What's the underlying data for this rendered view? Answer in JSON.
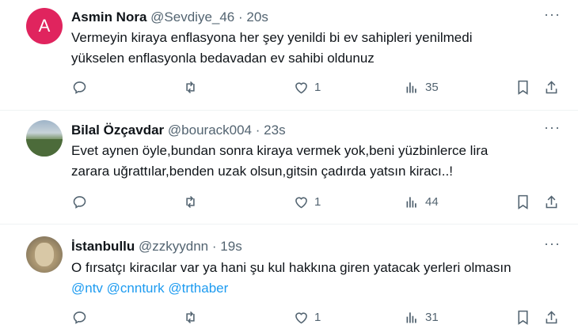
{
  "tweets": [
    {
      "avatar_letter": "A",
      "name": "Asmin Nora",
      "handle": "@Sevdiye_46",
      "separator": "·",
      "time": "20s",
      "more": "···",
      "text_lines": [
        "Vermeyin kiraya enflasyona her şey yenildi bi ev sahipleri yenilmedi",
        "yükselen enflasyonla bedavadan ev sahibi oldunuz"
      ],
      "likes": "1",
      "views": "35"
    },
    {
      "avatar_desc": "landscape photo avatar",
      "name": "Bilal Özçavdar",
      "handle": "@bourack004",
      "separator": "·",
      "time": "23s",
      "more": "···",
      "text_lines": [
        "Evet aynen öyle,bundan sonra kiraya vermek yok,beni yüzbinlerce lira",
        "zarara uğrattılar,benden uzak olsun,gitsin çadırda yatsın kiracı..!"
      ],
      "likes": "1",
      "views": "44"
    },
    {
      "avatar_desc": "cat photo avatar",
      "name": "İstanbullu",
      "handle": "@zzkyydnn",
      "separator": "·",
      "time": "19s",
      "more": "···",
      "text_lines": [
        "O fırsatçı kiracılar var ya hani şu kul hakkına giren yatacak yerleri olmasın"
      ],
      "mentions": [
        "@ntv",
        "@cnnturk",
        "@trthaber"
      ],
      "likes": "1",
      "views": "31"
    }
  ],
  "icons": {
    "reply": "reply-icon",
    "retweet": "retweet-icon",
    "like": "heart-icon",
    "views": "views-icon",
    "bookmark": "bookmark-icon",
    "share": "share-icon"
  },
  "colors": {
    "link": "#1d9bf0",
    "muted": "#536471",
    "avatar_a": "#e0245e"
  }
}
